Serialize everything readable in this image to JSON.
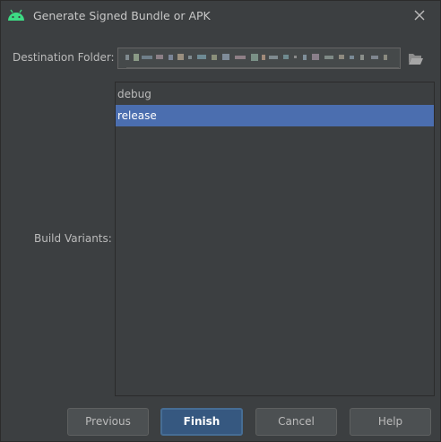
{
  "window": {
    "title": "Generate Signed Bundle or APK",
    "close_icon": "close-icon",
    "app_icon": "android-icon",
    "colors": {
      "background": "#3c3f41",
      "selection": "#4b6eaf",
      "default_button": "#365880",
      "android_green": "#3ddc84"
    }
  },
  "form": {
    "destination_label": "Destination Folder:",
    "destination_value_redacted": true,
    "browse_icon": "folder-open-icon",
    "build_variants_label": "Build Variants:",
    "variants": [
      {
        "label": "debug",
        "selected": false
      },
      {
        "label": "release",
        "selected": true
      }
    ]
  },
  "buttons": {
    "previous": "Previous",
    "finish": "Finish",
    "cancel": "Cancel",
    "help": "Help"
  }
}
